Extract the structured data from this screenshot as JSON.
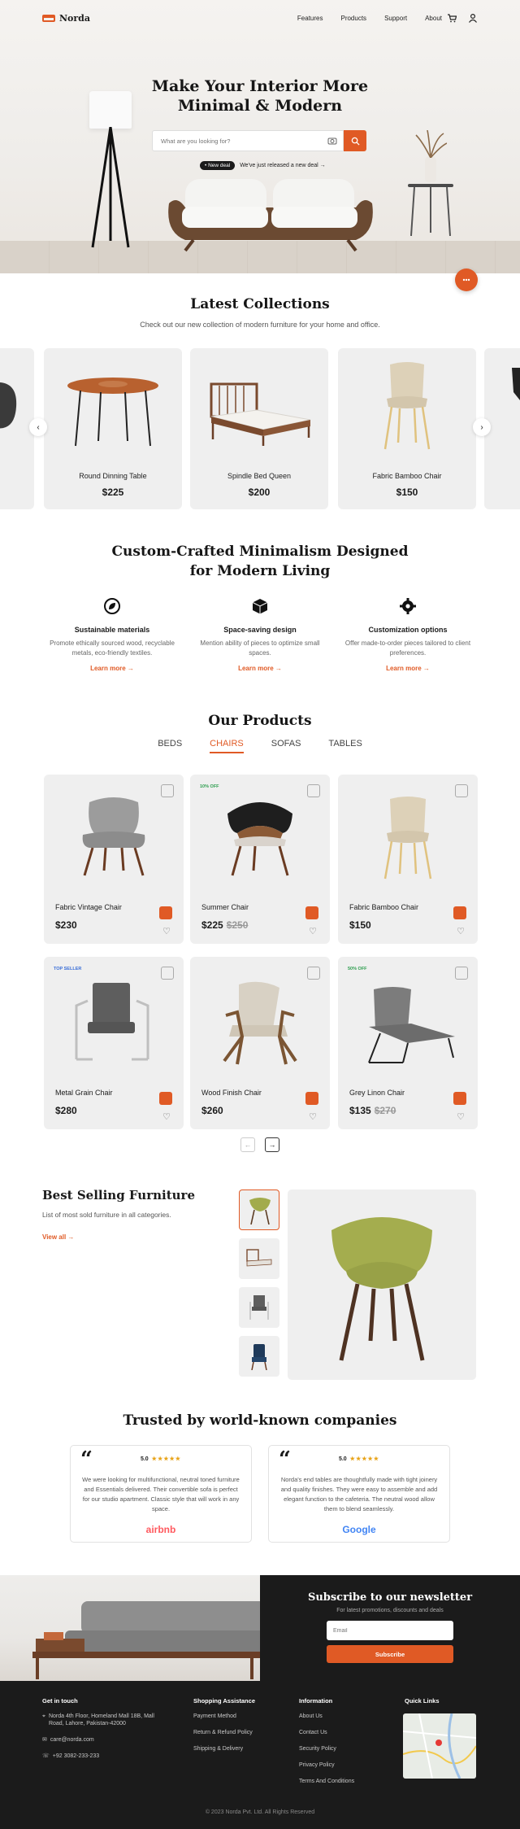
{
  "brand": {
    "name": "Norda",
    "accent": "#e05a25"
  },
  "nav": {
    "links": [
      "Features",
      "Products",
      "Support",
      "About"
    ],
    "icons": [
      "cart-icon",
      "user-icon"
    ]
  },
  "hero": {
    "title_line1": "Make Your Interior More",
    "title_line2": "Minimal & Modern",
    "search_placeholder": "What are you looking for?",
    "deal_badge": "• New deal",
    "deal_text": "We've just released a new deal →"
  },
  "collections": {
    "title": "Latest Collections",
    "subtitle": "Check out our new collection of modern furniture for your home and office.",
    "items": [
      {
        "name": "Round Dinning Table",
        "price": "$225"
      },
      {
        "name": "Spindle Bed Queen",
        "price": "$200"
      },
      {
        "name": "Fabric Bamboo Chair",
        "price": "$150"
      }
    ]
  },
  "features": {
    "title_line1": "Custom-Crafted Minimalism Designed",
    "title_line2": "for Modern Living",
    "items": [
      {
        "title": "Sustainable materials",
        "desc": "Promote ethically sourced wood, recyclable metals, eco-friendly textiles.",
        "link": "Learn more →",
        "icon": "leaf-recycle-icon"
      },
      {
        "title": "Space-saving design",
        "desc": "Mention ability of pieces to optimize small spaces.",
        "link": "Learn more →",
        "icon": "cube-icon"
      },
      {
        "title": "Customization options",
        "desc": "Offer made-to-order pieces tailored to client preferences.",
        "link": "Learn more →",
        "icon": "gear-icon"
      }
    ]
  },
  "products": {
    "title": "Our Products",
    "tabs": [
      "BEDS",
      "CHAIRS",
      "SOFAS",
      "TABLES"
    ],
    "active_tab": "CHAIRS",
    "items": [
      {
        "name": "Fabric Vintage Chair",
        "price": "$230",
        "old": "",
        "badge": ""
      },
      {
        "name": "Summer Chair",
        "price": "$225",
        "old": "$250",
        "badge": "10% OFF"
      },
      {
        "name": "Fabric Bamboo Chair",
        "price": "$150",
        "old": "",
        "badge": ""
      },
      {
        "name": "Metal Grain Chair",
        "price": "$280",
        "old": "",
        "badge": "TOP SELLER"
      },
      {
        "name": "Wood Finish Chair",
        "price": "$260",
        "old": "",
        "badge": ""
      },
      {
        "name": "Grey Linon Chair",
        "price": "$135",
        "old": "$270",
        "badge": "50% OFF"
      }
    ],
    "badge_colors": {
      "10% OFF": "#2e9e4f",
      "TOP SELLER": "#3b6fd8",
      "50% OFF": "#2e9e4f"
    }
  },
  "best": {
    "title": "Best Selling Furniture",
    "subtitle": "List of most sold furniture in all categories.",
    "link": "View all →"
  },
  "trusted": {
    "title": "Trusted by world-known companies",
    "items": [
      {
        "rating": "5.0",
        "stars": "★★★★★",
        "text": "We were looking for multifunctional, neutral toned furniture and Essentials delivered. Their convertible sofa is perfect for our studio apartment. Classic style that will work in any space.",
        "brand": "airbnb"
      },
      {
        "rating": "5.0",
        "stars": "★★★★★",
        "text": "Norda's end tables are thoughtfully made with tight joinery and quality finishes. They were easy to assemble and add elegant function to the cafeteria. The neutral wood allow them to blend seamlessly.",
        "brand": "Google"
      }
    ]
  },
  "newsletter": {
    "title": "Subscribe to our newsletter",
    "subtitle": "For latest promotions, discounts and deals",
    "placeholder": "Email",
    "button": "Subscribe"
  },
  "footer": {
    "col1": {
      "title": "Get in touch",
      "address": "Norda 4th Floor, Homeland Mall 18B, Mall Road, Lahore, Pakistan-42000",
      "email": "care@norda.com",
      "phone": "+92 3082-233-233"
    },
    "col2": {
      "title": "Shopping Assistance",
      "items": [
        "Payment Method",
        "Return & Refund Policy",
        "Shipping & Delivery"
      ]
    },
    "col3": {
      "title": "Information",
      "items": [
        "About Us",
        "Contact Us",
        "Security Policy",
        "Privacy Policy",
        "Terms And Conditions"
      ]
    },
    "col4": {
      "title": "Quick Links"
    },
    "copyright": "© 2023 Norda Pvt. Ltd. All Rights Reserved"
  }
}
